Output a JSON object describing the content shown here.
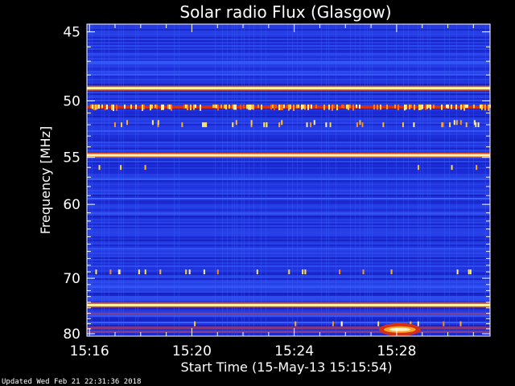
{
  "chart_data": {
    "type": "heatmap",
    "title": "Solar radio Flux (Glasgow)",
    "xlabel": "Start Time (15-May-13 15:15:54)",
    "ylabel": "Frequency [MHz]",
    "x_ticks": [
      "15:16",
      "15:20",
      "15:24",
      "15:28"
    ],
    "x_tick_minutes": [
      16,
      20,
      24,
      28
    ],
    "x_range_minutes": [
      15.9,
      31.65
    ],
    "y_ticks": [
      45,
      50,
      55,
      60,
      70,
      80
    ],
    "y_range": [
      44.5,
      80.5
    ],
    "y_scale": "reciprocal",
    "colormap": [
      "#05057a",
      "#1c2cd8",
      "#3a64ff",
      "#c01818",
      "#ff6a10",
      "#ffe040",
      "#ffffff"
    ],
    "emission_lines_mhz": [
      {
        "freq": 49.0,
        "intensity": 0.97
      },
      {
        "freq": 50.5,
        "intensity": 0.78
      },
      {
        "freq": 54.8,
        "intensity": 1.0
      },
      {
        "freq": 74.5,
        "intensity": 1.0
      },
      {
        "freq": 76.1,
        "intensity": 0.45
      },
      {
        "freq": 78.8,
        "intensity": 0.55
      },
      {
        "freq": 79.6,
        "intensity": 0.5
      }
    ],
    "burst": {
      "start": "15:27:30",
      "end": "15:28:45",
      "freq_range_mhz": [
        78.5,
        79.8
      ],
      "intensity": 0.95
    }
  },
  "footer": {
    "updated": "Updated Wed Feb 21 22:31:36 2018"
  }
}
